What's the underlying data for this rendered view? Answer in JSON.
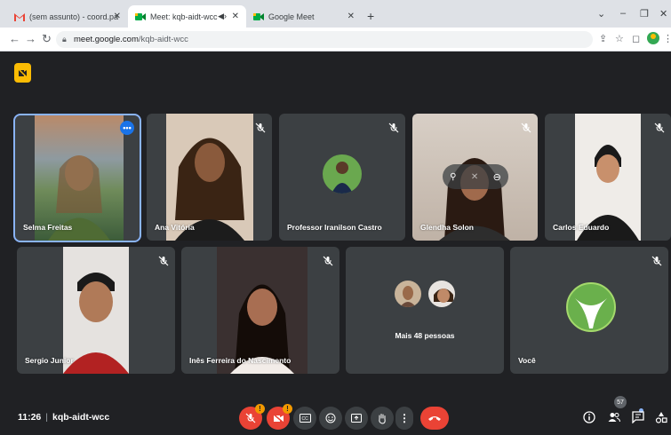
{
  "browser": {
    "tabs": [
      {
        "label": "(sem assunto) - coord.pacajus@",
        "active": false
      },
      {
        "label": "Meet: kqb-aidt-wcc",
        "active": true
      },
      {
        "label": "Google Meet",
        "active": false
      }
    ],
    "new_tab_label": "+",
    "url_domain": "meet.google.com",
    "url_path": "/kqb-aidt-wcc"
  },
  "participants": [
    {
      "name": "Selma Freitas",
      "muted": false,
      "highlighted": true
    },
    {
      "name": "Ana Vitória",
      "muted": true
    },
    {
      "name": "Professor Iranilson Castro",
      "muted": true
    },
    {
      "name": "Glendha Solon",
      "muted": true
    },
    {
      "name": "Carlos Eduardo",
      "muted": true
    },
    {
      "name": "Sergio Junior",
      "muted": true
    },
    {
      "name": "Inês Ferreira do Nascimento",
      "muted": true
    },
    {
      "name": "Mais 48 pessoas",
      "muted": false
    },
    {
      "name": "Você",
      "muted": true
    }
  ],
  "meeting": {
    "time": "11:26",
    "code": "kqb-aidt-wcc",
    "participant_count": "57"
  },
  "colors": {
    "background": "#202124",
    "tile": "#3c4043",
    "accent": "#8ab4f8",
    "end_call": "#ea4335",
    "warning": "#f29900"
  },
  "icons": {
    "controls": [
      "mic-off-icon",
      "camera-off-icon",
      "captions-icon",
      "emoji-icon",
      "present-icon",
      "raise-hand-icon",
      "more-options-icon",
      "end-call-icon"
    ],
    "right": [
      "info-icon",
      "people-icon",
      "chat-icon",
      "activities-icon"
    ]
  }
}
